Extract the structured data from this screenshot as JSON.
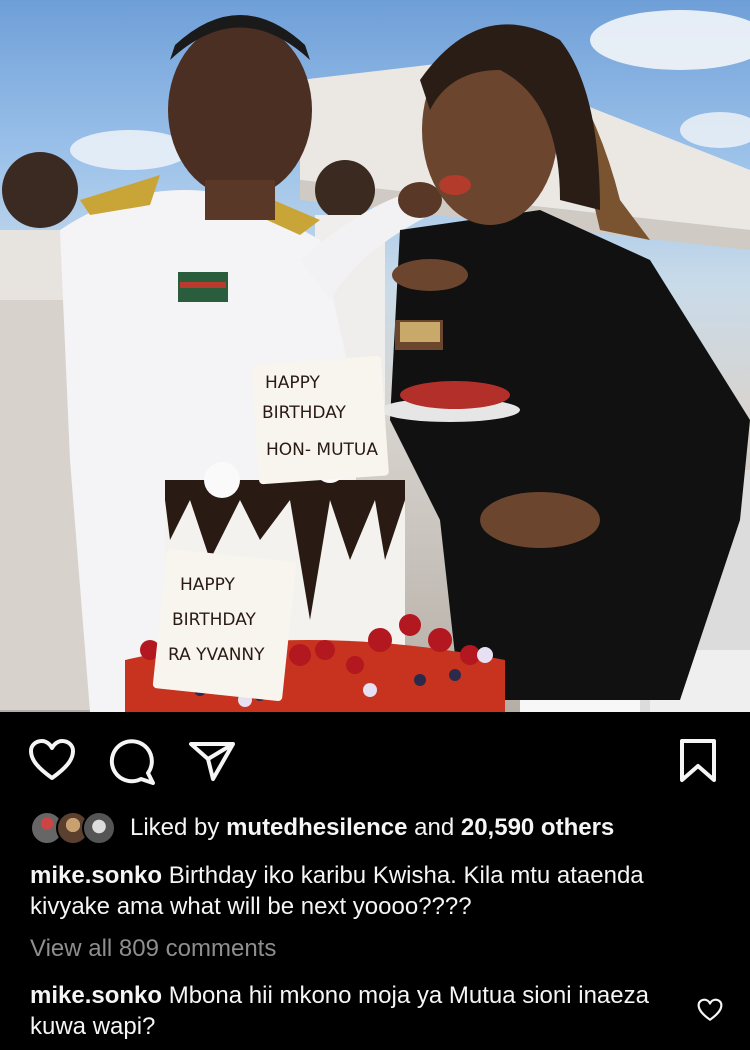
{
  "post": {
    "photo_alt": "",
    "cake_text_top": [
      "HAPPY",
      "BIRTHDAY",
      "HON- MUTUA"
    ],
    "cake_text_bottom": [
      "HAPPY",
      "BIRTHDAY",
      "RA YVANNY"
    ]
  },
  "actions": {
    "like_icon": "heart-icon",
    "comment_icon": "comment-bubble-icon",
    "share_icon": "paper-plane-icon",
    "save_icon": "bookmark-icon"
  },
  "likes": {
    "prefix": "Liked by",
    "user": "mutedhesilence",
    "middle": "and",
    "count": "20,590 others"
  },
  "caption": {
    "username": "mike.sonko",
    "text": "Birthday iko karibu Kwisha. Kila mtu ataenda kivyake ama what will be next yoooo????"
  },
  "view_all_comments": "View all 809 comments",
  "comment": {
    "username": "mike.sonko",
    "text": "Mbona hii mkono moja ya Mutua sioni inaeza kuwa wapi?"
  },
  "colors": {
    "background": "#000000",
    "text": "#f5f5f5",
    "muted": "#8e8e8e"
  }
}
